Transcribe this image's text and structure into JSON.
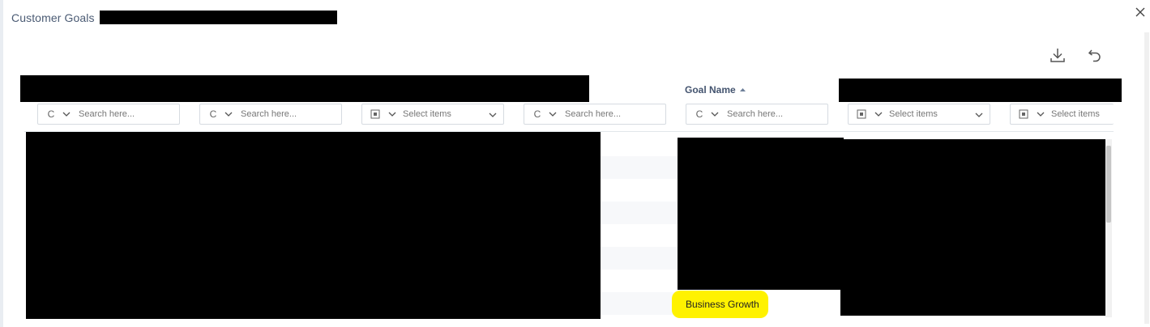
{
  "dialog": {
    "title": "Customer Goals",
    "close_icon": "close-icon"
  },
  "toolbar": {
    "download_icon": "download-icon",
    "reset_icon": "undo-icon"
  },
  "grid": {
    "columns": [
      {
        "header": "Goal Name",
        "sort": "ascending"
      }
    ],
    "filters": [
      {
        "type": "text",
        "operator": "C",
        "placeholder": "Search here..."
      },
      {
        "type": "text",
        "operator": "C",
        "placeholder": "Search here..."
      },
      {
        "type": "select",
        "placeholder": "Select items"
      },
      {
        "type": "text",
        "operator": "C",
        "placeholder": "Search here..."
      },
      {
        "type": "text",
        "operator": "C",
        "placeholder": "Search here..."
      },
      {
        "type": "select",
        "placeholder": "Select items"
      },
      {
        "type": "select",
        "placeholder": "Select items"
      }
    ],
    "highlighted_goal": "Business Growth"
  },
  "colors": {
    "highlight": "#fff200",
    "header_text": "#44546f",
    "title_text": "#4b5b74"
  }
}
